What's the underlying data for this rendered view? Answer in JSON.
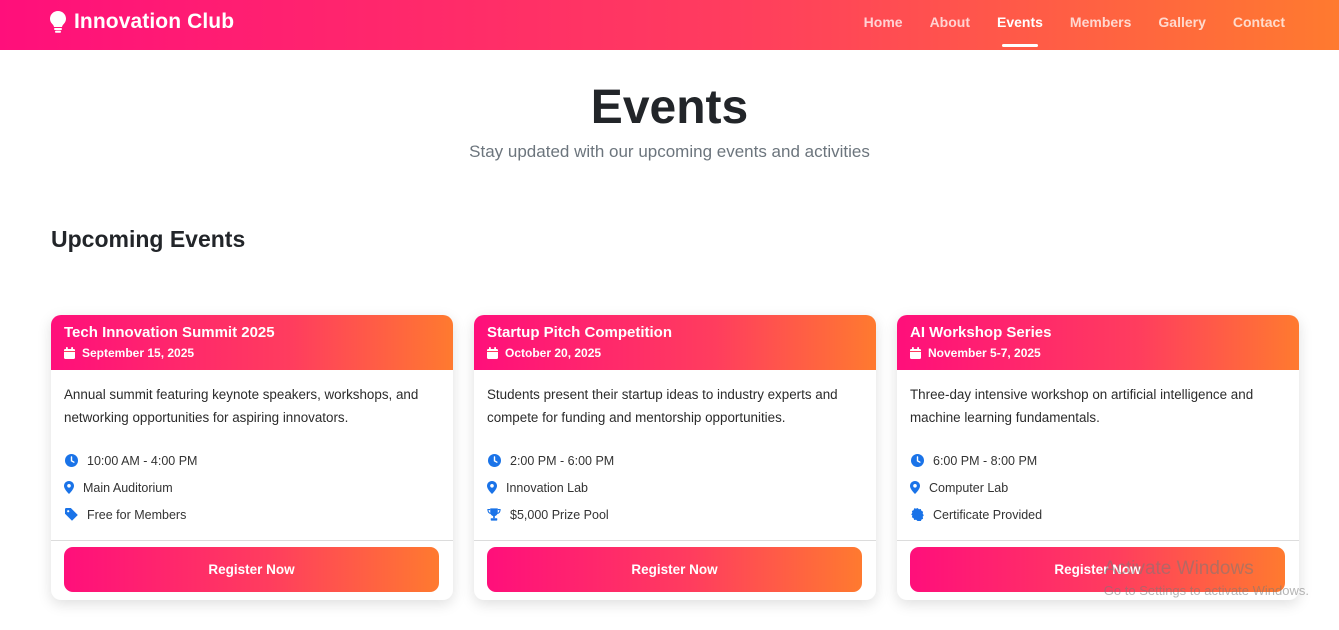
{
  "navbar": {
    "brand": "Innovation Club",
    "brand_icon": "lightbulb-icon",
    "links": [
      {
        "label": "Home",
        "active": false
      },
      {
        "label": "About",
        "active": false
      },
      {
        "label": "Events",
        "active": true
      },
      {
        "label": "Members",
        "active": false
      },
      {
        "label": "Gallery",
        "active": false
      },
      {
        "label": "Contact",
        "active": false
      }
    ]
  },
  "hero": {
    "title": "Events",
    "subtitle": "Stay updated with our upcoming events and activities"
  },
  "section": {
    "title": "Upcoming Events"
  },
  "events": [
    {
      "title": "Tech Innovation Summit 2025",
      "date": "September 15, 2025",
      "description": "Annual summit featuring keynote speakers, workshops, and networking opportunities for aspiring innovators.",
      "meta": [
        {
          "icon": "clock-icon",
          "text": "10:00 AM - 4:00 PM"
        },
        {
          "icon": "map-pin-icon",
          "text": "Main Auditorium"
        },
        {
          "icon": "tag-icon",
          "text": "Free for Members"
        }
      ],
      "button": "Register Now"
    },
    {
      "title": "Startup Pitch Competition",
      "date": "October 20, 2025",
      "description": "Students present their startup ideas to industry experts and compete for funding and mentorship opportunities.",
      "meta": [
        {
          "icon": "clock-icon",
          "text": "2:00 PM - 6:00 PM"
        },
        {
          "icon": "map-pin-icon",
          "text": "Innovation Lab"
        },
        {
          "icon": "trophy-icon",
          "text": "$5,000 Prize Pool"
        }
      ],
      "button": "Register Now"
    },
    {
      "title": "AI Workshop Series",
      "date": "November 5-7, 2025",
      "description": "Three-day intensive workshop on artificial intelligence and machine learning fundamentals.",
      "meta": [
        {
          "icon": "clock-icon",
          "text": "6:00 PM - 8:00 PM"
        },
        {
          "icon": "map-pin-icon",
          "text": "Computer Lab"
        },
        {
          "icon": "certificate-icon",
          "text": "Certificate Provided"
        }
      ],
      "button": "Register Now"
    }
  ],
  "watermark": {
    "line1": "Activate Windows",
    "line2": "Go to Settings to activate Windows."
  },
  "colors": {
    "gradient_start": "#ff0f7b",
    "gradient_end": "#ff7a2f",
    "icon_blue": "#1a73e8",
    "heading": "#222529"
  }
}
